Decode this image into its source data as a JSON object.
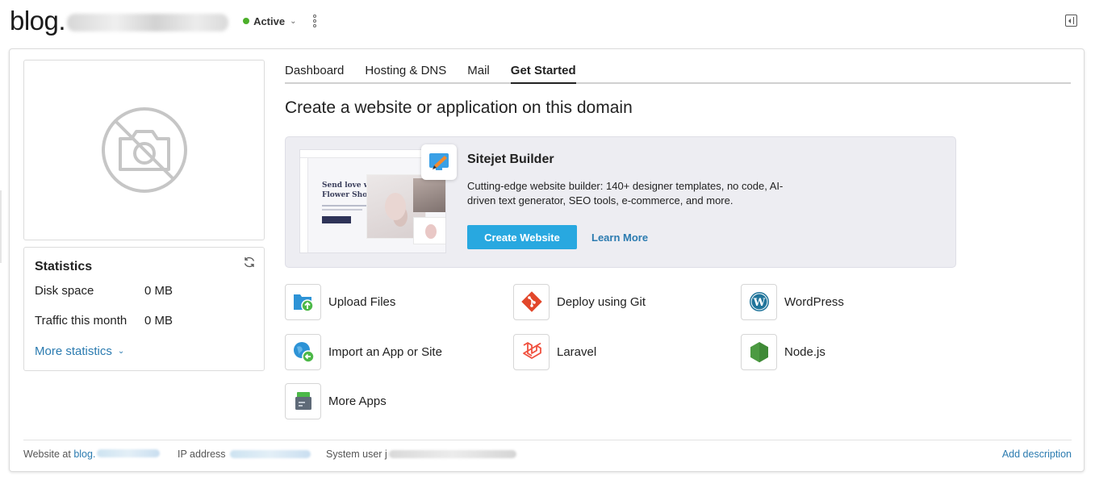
{
  "header": {
    "domain_prefix": "blog.",
    "status_label": "Active",
    "status_color": "#4caf2a"
  },
  "tabs": [
    {
      "label": "Dashboard"
    },
    {
      "label": "Hosting & DNS"
    },
    {
      "label": "Mail"
    },
    {
      "label": "Get Started",
      "active": true
    }
  ],
  "main": {
    "title": "Create a website or application on this domain"
  },
  "sitejet": {
    "name": "Sitejet Builder",
    "description": "Cutting-edge website builder: 140+ designer templates, no code, AI-driven text generator, SEO tools, e-commerce, and more.",
    "create_label": "Create Website",
    "learn_label": "Learn More",
    "mock_headline_1": "Send love with",
    "mock_headline_2": "Flower Shop",
    "accent_color": "#28a8e0"
  },
  "tiles": {
    "upload_files": "Upload Files",
    "deploy_git": "Deploy using Git",
    "wordpress": "WordPress",
    "import_app": "Import an App or Site",
    "laravel": "Laravel",
    "nodejs": "Node.js",
    "more_apps": "More Apps"
  },
  "statistics": {
    "title": "Statistics",
    "disk_label": "Disk space",
    "disk_value": "0 MB",
    "traffic_label": "Traffic this month",
    "traffic_value": "0 MB",
    "more_label": "More statistics"
  },
  "footer": {
    "website_label": "Website at",
    "website_prefix": "blog.",
    "ip_label": "IP address",
    "system_user_label": "System user",
    "system_user_prefix": "j",
    "add_description": "Add description"
  },
  "icons": {
    "no_screenshot": "camera-off-icon",
    "refresh": "refresh-icon",
    "panel_toggle": "sidebar-toggle-icon",
    "kebab": "more-vertical-icon"
  }
}
